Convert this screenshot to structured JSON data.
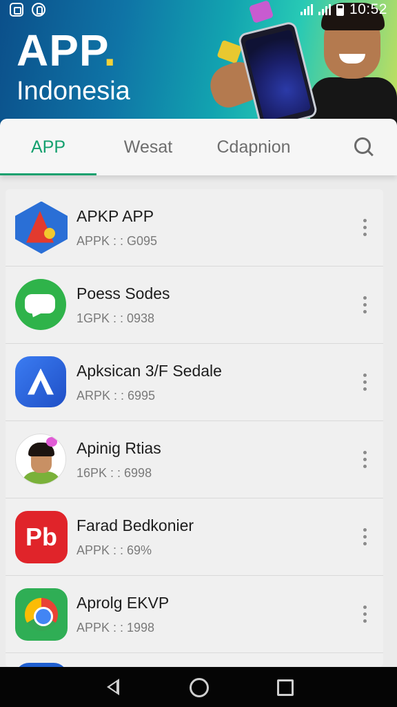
{
  "status_bar": {
    "time": "10:52"
  },
  "banner": {
    "title_main": "APP",
    "title_dot": ".",
    "title_sub": "Indonesia"
  },
  "tabs": [
    {
      "label": "APP",
      "active": true
    },
    {
      "label": "Wesat",
      "active": false
    },
    {
      "label": "Cdapnion",
      "active": false
    }
  ],
  "apps": [
    {
      "name": "APKP APP",
      "meta": "APPK : : G095",
      "icon": "hexagon-app-icon"
    },
    {
      "name": "Poess Sodes",
      "meta": "1GPK : : 0938",
      "icon": "chat-bubble-icon"
    },
    {
      "name": "Apksican 3/F Sedale",
      "meta": "ARPK : : 6995",
      "icon": "letter-a-icon"
    },
    {
      "name": "Apinig Rtias",
      "meta": "16PK : : 6998",
      "icon": "avatar-face-icon"
    },
    {
      "name": "Farad Bedkonier",
      "meta": "APPK : : 69%",
      "icon": "pb-logo-icon"
    },
    {
      "name": "Aprolg EKVP",
      "meta": "APPK : : 1998",
      "icon": "chrome-icon"
    }
  ],
  "app_badges": {
    "pb_text": "Pb"
  },
  "colors": {
    "accent": "#14a06e",
    "banner_start": "#0b4f8a",
    "banner_end": "#c8e05a"
  }
}
